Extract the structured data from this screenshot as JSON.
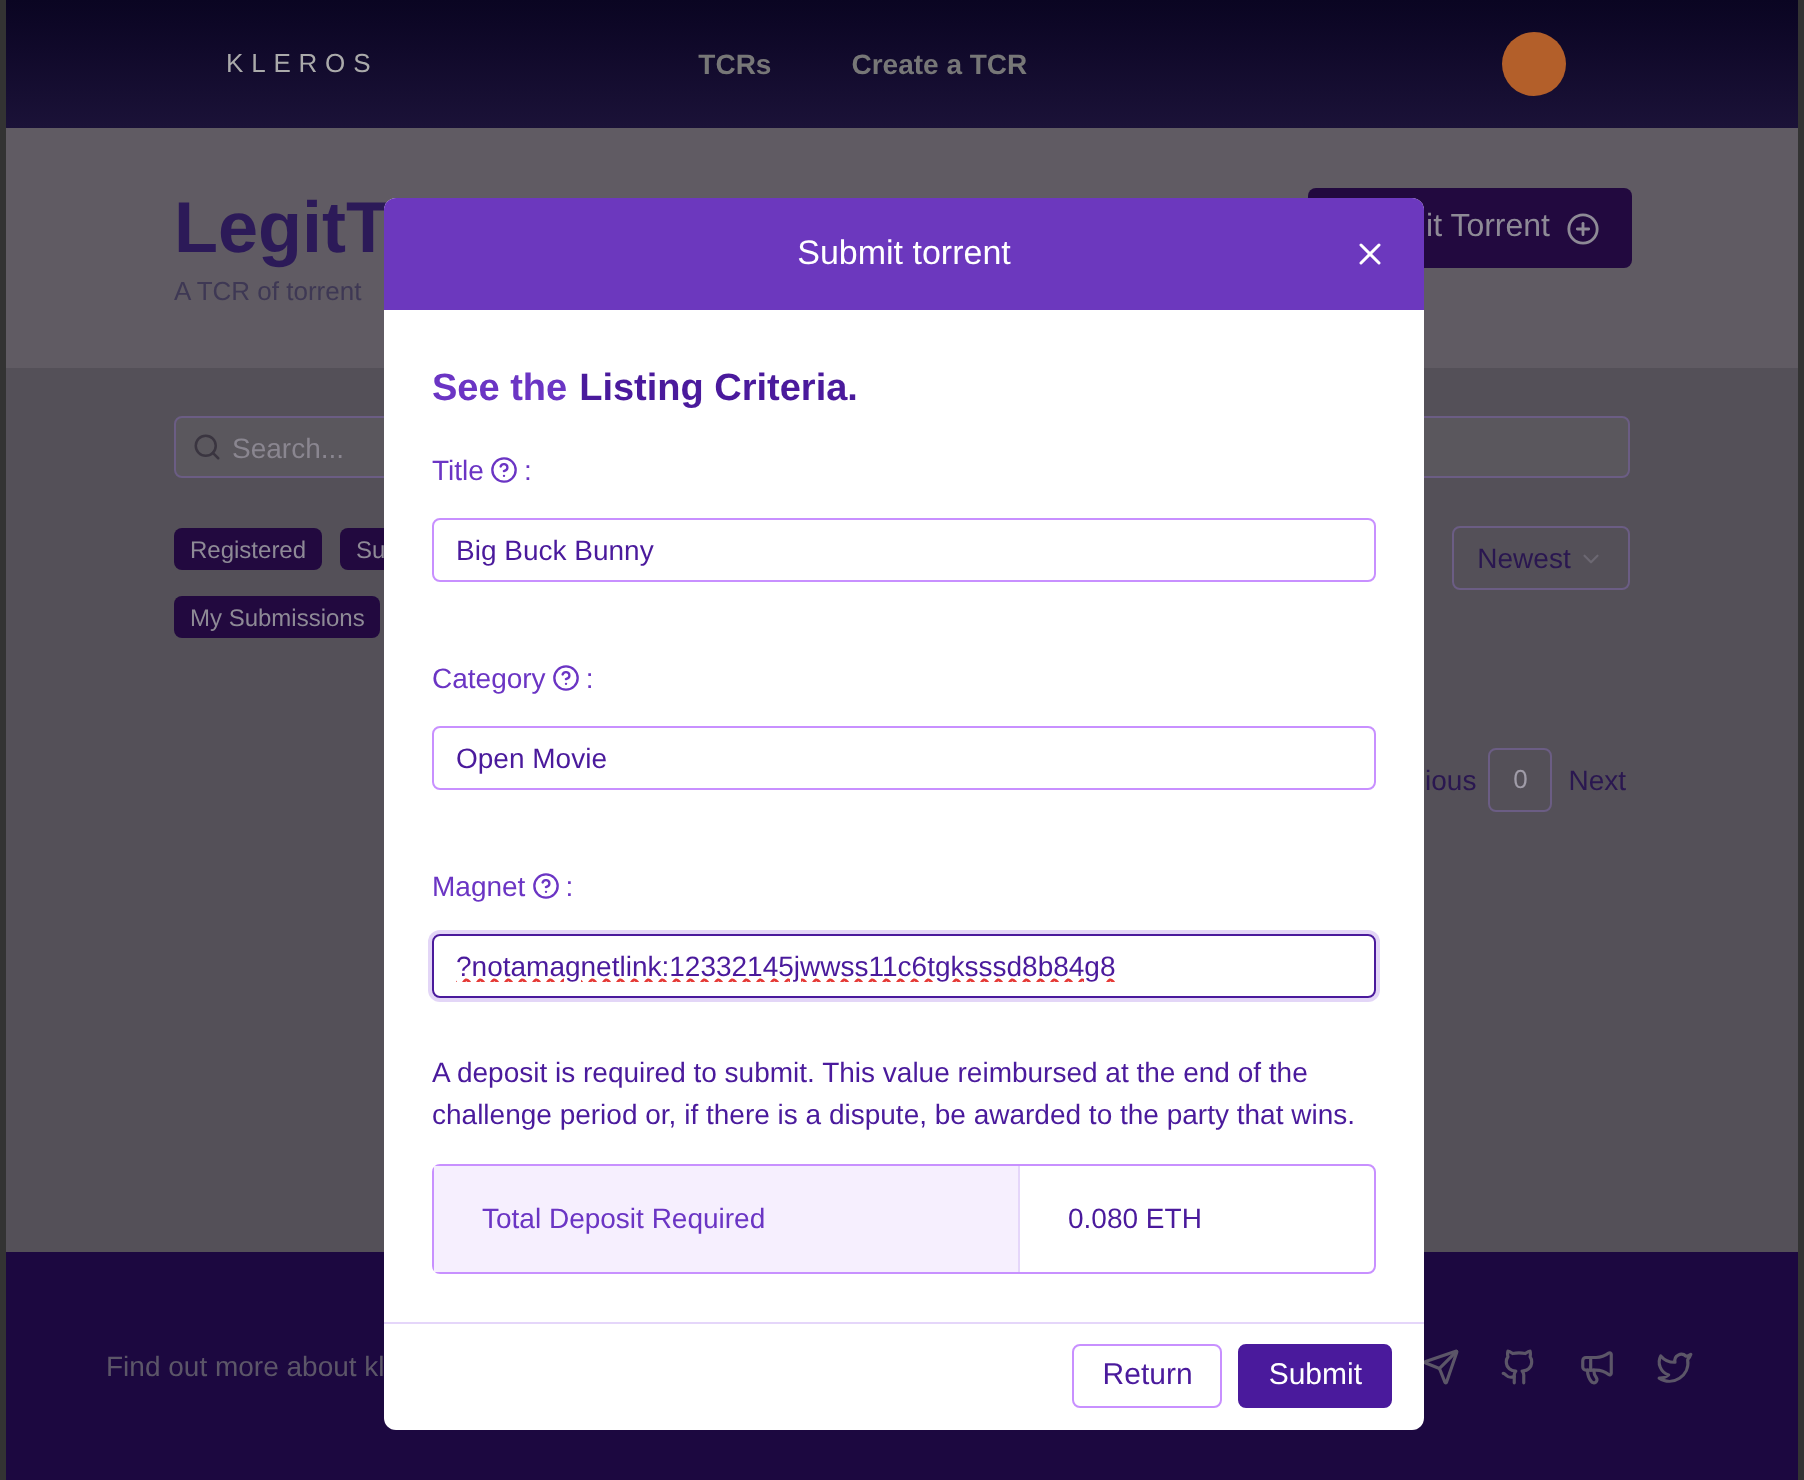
{
  "nav": {
    "logo": "KLEROS",
    "links": [
      "TCRs",
      "Create a TCR"
    ]
  },
  "header": {
    "title": "LegitT",
    "subtitle": "A TCR of torrent",
    "submit_button": "it Torrent"
  },
  "search": {
    "placeholder": "Search..."
  },
  "filters": [
    {
      "label": "Registered",
      "selected": true
    },
    {
      "label": "Su",
      "selected": true
    },
    {
      "label": "My Submissions",
      "selected": true
    }
  ],
  "sort": {
    "value": "Newest"
  },
  "pagination": {
    "previous": "ious",
    "page": "0",
    "next": "Next"
  },
  "footer": {
    "text": "Find out more about kl"
  },
  "modal": {
    "title": "Submit torrent",
    "heading": {
      "text": "See the",
      "link": "Listing Criteria."
    },
    "fields": [
      {
        "label": "Title",
        "colon": ":",
        "value": "Big Buck Bunny",
        "focused": false,
        "misspelled": false
      },
      {
        "label": "Category",
        "colon": ":",
        "value": "Open Movie",
        "focused": false,
        "misspelled": false
      },
      {
        "label": "Magnet",
        "colon": ":",
        "value": "?notamagnetlink:12332145jwwss11c6tgksssd8b84g8",
        "focused": true,
        "misspelled": true
      }
    ],
    "deposit_note": "A deposit is required to submit. This value reimbursed at the end of the challenge period or, if there is a dispute, be awarded to the party that wins.",
    "deposit": {
      "label": "Total Deposit Required",
      "value": "0.080 ETH"
    },
    "buttons": [
      {
        "label": "Return",
        "kind": "secondary"
      },
      {
        "label": "Submit",
        "kind": "primary"
      }
    ]
  }
}
